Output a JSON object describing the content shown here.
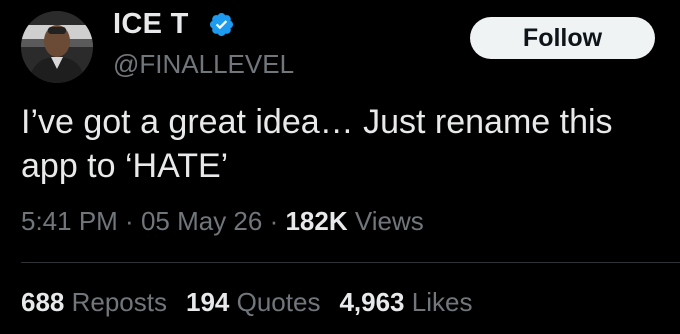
{
  "author": {
    "display_name": "ICE T",
    "handle": "@FINALLEVEL",
    "verified": true,
    "avatar_icon": "profile-photo"
  },
  "follow_label": "Follow",
  "tweet": {
    "text": "I’ve got a great idea… Just rename this app to ‘HATE’"
  },
  "meta": {
    "time": "5:41 PM",
    "sep1": " · ",
    "date": "05 May 26",
    "sep2": " · ",
    "views_count": "182K",
    "views_label": " Views"
  },
  "stats": {
    "reposts_count": "688",
    "reposts_label": " Reposts",
    "quotes_count": "194",
    "quotes_label": " Quotes",
    "likes_count": "4,963",
    "likes_label": " Likes"
  },
  "colors": {
    "background": "#000000",
    "primary_text": "#e7e9ea",
    "secondary_text": "#71767b",
    "verified_blue": "#1d9bf0",
    "follow_bg": "#eff3f4",
    "follow_text": "#0f1419"
  }
}
